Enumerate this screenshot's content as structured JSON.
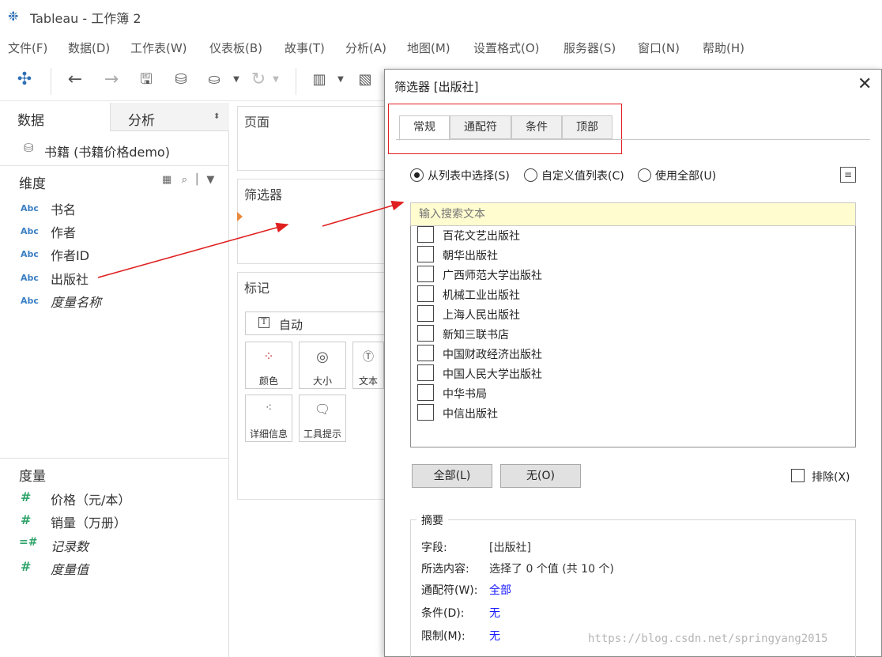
{
  "window": {
    "app_icon": "tableau-logo-icon",
    "title": "Tableau - 工作簿 2"
  },
  "menu": [
    "文件(F)",
    "数据(D)",
    "工作表(W)",
    "仪表板(B)",
    "故事(T)",
    "分析(A)",
    "地图(M)",
    "设置格式(O)",
    "服务器(S)",
    "窗口(N)",
    "帮助(H)"
  ],
  "toolbar": {
    "icons": [
      "tableau-logo-icon",
      "back-arrow-icon",
      "forward-arrow-icon",
      "save-icon",
      "new-datasource-icon",
      "pause-updates-icon",
      "chevron-down-icon",
      "refresh-icon",
      "new-sheet-icon",
      "chevron-down-icon",
      "show-me-icon"
    ]
  },
  "left_pane": {
    "tab_data": "数据",
    "tab_analysis": "分析",
    "datasource": "书籍 (书籍价格demo)",
    "dimensions_header": "维度",
    "dimensions": [
      {
        "type": "Abc",
        "name": "书名",
        "italic": false
      },
      {
        "type": "Abc",
        "name": "作者",
        "italic": false
      },
      {
        "type": "Abc",
        "name": "作者ID",
        "italic": false
      },
      {
        "type": "Abc",
        "name": "出版社",
        "italic": false
      },
      {
        "type": "Abc",
        "name": "度量名称",
        "italic": true
      }
    ],
    "measures_header": "度量",
    "measures": [
      {
        "type": "#",
        "name": "价格（元/本）",
        "italic": false
      },
      {
        "type": "#",
        "name": "销量（万册）",
        "italic": false
      },
      {
        "type": "=#",
        "name": "记录数",
        "italic": true
      },
      {
        "type": "#",
        "name": "度量值",
        "italic": true
      }
    ]
  },
  "shelves": {
    "pages": "页面",
    "filters": "筛选器",
    "marks": "标记",
    "mark_type": "自动",
    "mark_buttons": [
      {
        "icon": "color-dots-icon",
        "label": "颜色"
      },
      {
        "icon": "size-icon",
        "label": "大小"
      },
      {
        "icon": "text-icon",
        "label": "文本"
      },
      {
        "icon": "detail-icon",
        "label": "详细信息"
      },
      {
        "icon": "tooltip-icon",
        "label": "工具提示"
      }
    ]
  },
  "dialog": {
    "title": "筛选器 [出版社]",
    "tabs": [
      "常规",
      "通配符",
      "条件",
      "顶部"
    ],
    "active_tab": "常规",
    "radios": [
      {
        "label": "从列表中选择(S)",
        "checked": true
      },
      {
        "label": "自定义值列表(C)",
        "checked": false
      },
      {
        "label": "使用全部(U)",
        "checked": false
      }
    ],
    "search_placeholder": "输入搜索文本",
    "items": [
      "百花文艺出版社",
      "朝华出版社",
      "广西师范大学出版社",
      "机械工业出版社",
      "上海人民出版社",
      "新知三联书店",
      "中国财政经济出版社",
      "中国人民大学出版社",
      "中华书局",
      "中信出版社"
    ],
    "btn_all": "全部(L)",
    "btn_none": "无(O)",
    "exclude_label": "排除(X)",
    "summary": {
      "title": "摘要",
      "rows": [
        {
          "label": "字段:",
          "value": "[出版社]",
          "link": false
        },
        {
          "label": "所选内容:",
          "value": "选择了 0 个值 (共 10 个)",
          "link": false
        },
        {
          "label": "通配符(W):",
          "value": "全部",
          "link": true
        },
        {
          "label": "条件(D):",
          "value": "无",
          "link": true
        },
        {
          "label": "限制(M):",
          "value": "无",
          "link": true
        }
      ]
    }
  },
  "watermark": "https://blog.csdn.net/springyang2015",
  "colors": {
    "annotation_red": "#e02020",
    "search_bg": "#fffcd0",
    "link_blue": "#1a1aff",
    "dimension_blue": "#3b7fc4",
    "measure_green": "#2ea36a"
  }
}
